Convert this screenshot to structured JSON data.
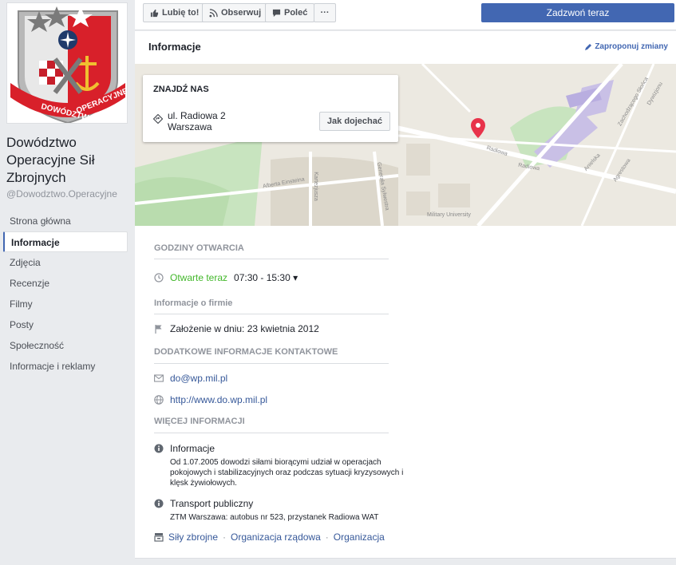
{
  "page": {
    "name": "Dowództwo Operacyjne Sił Zbrojnych",
    "handle": "@Dowodztwo.Operacyjne"
  },
  "logo": {
    "text_left": "DOWÓDZTWO",
    "text_right": "OPERACYJNE"
  },
  "nav": [
    {
      "label": "Strona główna",
      "active": false
    },
    {
      "label": "Informacje",
      "active": true
    },
    {
      "label": "Zdjęcia",
      "active": false
    },
    {
      "label": "Recenzje",
      "active": false
    },
    {
      "label": "Filmy",
      "active": false
    },
    {
      "label": "Posty",
      "active": false
    },
    {
      "label": "Społeczność",
      "active": false
    },
    {
      "label": "Informacje i reklamy",
      "active": false
    }
  ],
  "actions": {
    "like": "Lubię to!",
    "follow": "Obserwuj",
    "recommend": "Poleć",
    "more": "···",
    "call": "Zadzwoń teraz"
  },
  "info": {
    "title": "Informacje",
    "suggest": "Zaproponuj zmiany"
  },
  "map": {
    "find_us": "ZNAJDŹ NAS",
    "address_line1": "ul. Radiowa 2",
    "address_line2": "Warszawa",
    "directions": "Jak dojechać",
    "labels": {
      "street1": "Radiowa",
      "street2": "Radiowa",
      "einstein": "Alberta Einsteina",
      "university": "Military University",
      "kartezjusza": "Kartezjusza",
      "sylwestra": "Generała Sylwestra",
      "anielska": "Anielska",
      "agrestowa": "Agrestowa",
      "zachodzie": "Zachodzącego Słońca",
      "dywizjonu": "Dywizjonu"
    }
  },
  "hours": {
    "heading": "GODZINY OTWARCIA",
    "status": "Otwarte teraz",
    "range": "07:30 - 15:30 ▾"
  },
  "company": {
    "heading": "Informacje o firmie",
    "founded": "Założenie w dniu: 23 kwietnia 2012"
  },
  "contact": {
    "heading": "DODATKOWE INFORMACJE KONTAKTOWE",
    "email": "do@wp.mil.pl",
    "website": "http://www.do.wp.mil.pl"
  },
  "more": {
    "heading": "WIĘCEJ INFORMACJI",
    "about_title": "Informacje",
    "about_text": "Od 1.07.2005 dowodzi siłami biorącymi udział w operacjach pokojowych i stabilizacyjnych oraz podczas sytuacji kryzysowych i klęsk żywiołowych.",
    "transport_title": "Transport publiczny",
    "transport_text": "ZTM Warszawa: autobus nr 523, przystanek Radiowa WAT",
    "categories": [
      "Siły zbrojne",
      "Organizacja rządowa",
      "Organizacja"
    ],
    "category_sep": "·"
  },
  "colors": {
    "brand_blue": "#4267b2",
    "link": "#365899",
    "open_green": "#42b72a",
    "pin_red": "#e8334a"
  }
}
